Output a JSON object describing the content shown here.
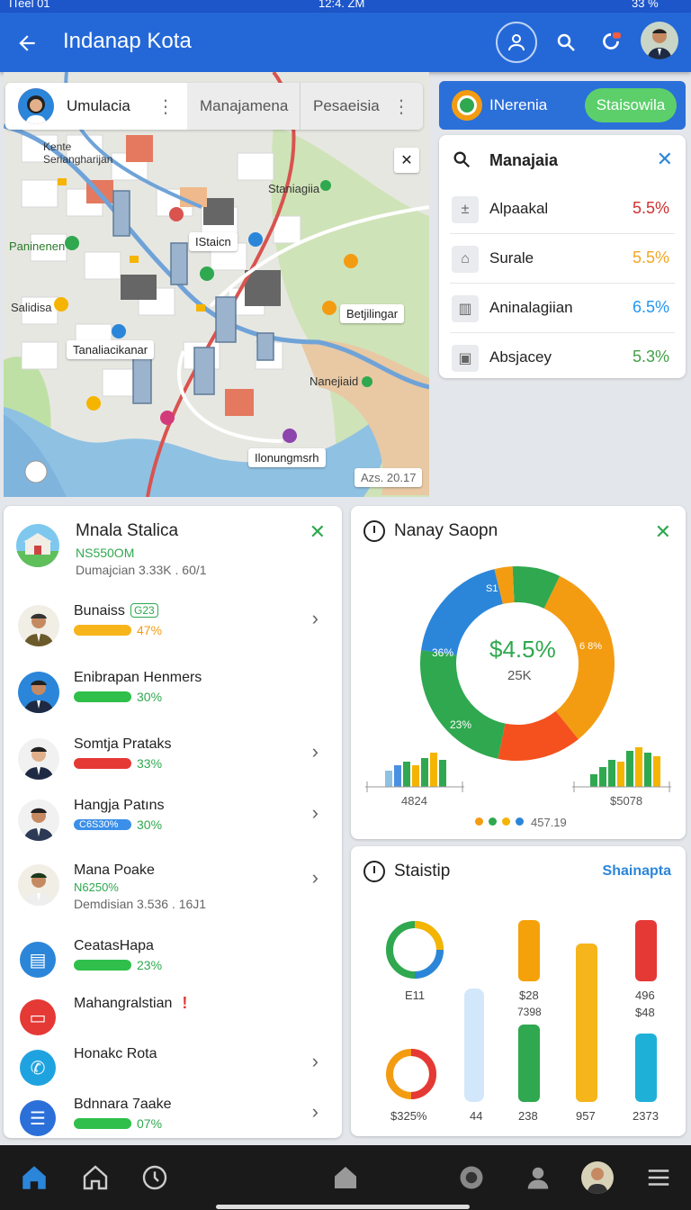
{
  "status_bar": {
    "left": "ITeel 01",
    "time": "12:4. ZM",
    "battery": "33 %"
  },
  "app_bar": {
    "title": "Indanap Kota"
  },
  "map": {
    "tabs": [
      "Umulacia",
      "Manajamena",
      "Pesaeisia"
    ],
    "labels": {
      "kente": "Kente\nSeriangharijan",
      "staniagiia": "Staniagiia",
      "panineren": "Paninenen",
      "salidisa": "Salidisa",
      "istaicn": "IStaicn",
      "betjilingar": "Betjilingar",
      "tamaic": "Tanaliacikanar",
      "nanejiaid": "Nanejiaid",
      "ilonung": "Ilonungmsrh",
      "scale": "Azs. 20.17"
    }
  },
  "top_right_bar": {
    "label": "INerenia",
    "button": "Staisowila"
  },
  "manajaia_card": {
    "title": "Manajaia",
    "rows": [
      {
        "icon": "plus-minus-icon",
        "label": "Alpaakal",
        "value": "5.5%",
        "color": "#d32f2f"
      },
      {
        "icon": "home-icon",
        "label": "Surale",
        "value": "5.5%",
        "color": "#f5a623"
      },
      {
        "icon": "building-icon",
        "label": "Aninalagiian",
        "value": "6.5%",
        "color": "#2196f3"
      },
      {
        "icon": "box-icon",
        "label": "Absjacey",
        "value": "5.3%",
        "color": "#43a047"
      }
    ]
  },
  "list_card": {
    "header": {
      "title": "Mnala Stalica",
      "sub1": "NS550OM",
      "sub2": "Dumajcian  3.33K . 60/1"
    },
    "items": [
      {
        "name": "Bunaiss",
        "badge": "G23",
        "value": "47%",
        "bar_color": "#f7b51b",
        "value_color": "#f39c12",
        "chevron": true
      },
      {
        "name": "Enibrapan Henmers",
        "value": "30%",
        "bar_color": "#2fbf4a",
        "value_color": "#2fa84f",
        "chevron": false
      },
      {
        "name": "Somtja Prataks",
        "value": "33%",
        "bar_color": "#e53935",
        "value_color": "#2fa84f",
        "chevron": true
      },
      {
        "name": "Hangja Patıns",
        "bar_text": "C6S30%",
        "value": "30%",
        "bar_color": "#3b8fe8",
        "value_color": "#2fa84f",
        "chevron": true
      },
      {
        "name": "Mana Poake",
        "sub1": "N6250%",
        "sub2": "Demdisian  3.536 . 16J1",
        "chevron": true
      },
      {
        "name": "CeatasHapa",
        "value": "23%",
        "bar_color": "#2fbf4a",
        "value_color": "#2fa84f",
        "chevron": false
      },
      {
        "name": "Mahangralstian",
        "mark": "!",
        "chevron": false
      },
      {
        "name": "Honakc Rota",
        "chevron": true
      },
      {
        "name": "Bdnnara 7aake",
        "value": "07%",
        "bar_color": "#2fbf4a",
        "value_color": "#2fa84f",
        "chevron": true
      }
    ]
  },
  "donut_card": {
    "title": "Nanay Saopn",
    "center_value": "$4.5%",
    "center_sub": "25K",
    "slice_labels": [
      "S1",
      "36%",
      "23%",
      "6 8%"
    ],
    "left_axis_value": "4824",
    "right_axis_value": "$5078",
    "footer_value": "457.19"
  },
  "stats_card": {
    "title": "Staistip",
    "link": "Shainapta",
    "labels": {
      "ring1": "E11",
      "ring2": "$325%",
      "bar1": "44",
      "bar2_top": "$28",
      "bar2_mid": "7398",
      "bar2_bottom": "238",
      "bar3": "957",
      "bar4_top": "496",
      "bar4_mid": "$48",
      "bar4_bottom": "2373"
    }
  },
  "chart_data": {
    "type": "pie",
    "title": "Nanay Saopn",
    "slices": [
      {
        "label": "S1",
        "value": 8,
        "color": "#2fa84f"
      },
      {
        "label": "6 8%",
        "value": 32,
        "color": "#f39c12"
      },
      {
        "label": "",
        "value": 14,
        "color": "#f4511e"
      },
      {
        "label": "23%",
        "value": 24,
        "color": "#2fa84f"
      },
      {
        "label": "36%",
        "value": 19,
        "color": "#2b86d9"
      },
      {
        "label": "",
        "value": 3,
        "color": "#f39c12"
      }
    ]
  },
  "colors": {
    "primary": "#2468d8",
    "green": "#2fa84f",
    "orange": "#f39c12",
    "red": "#e53935",
    "blue": "#2b86d9"
  }
}
